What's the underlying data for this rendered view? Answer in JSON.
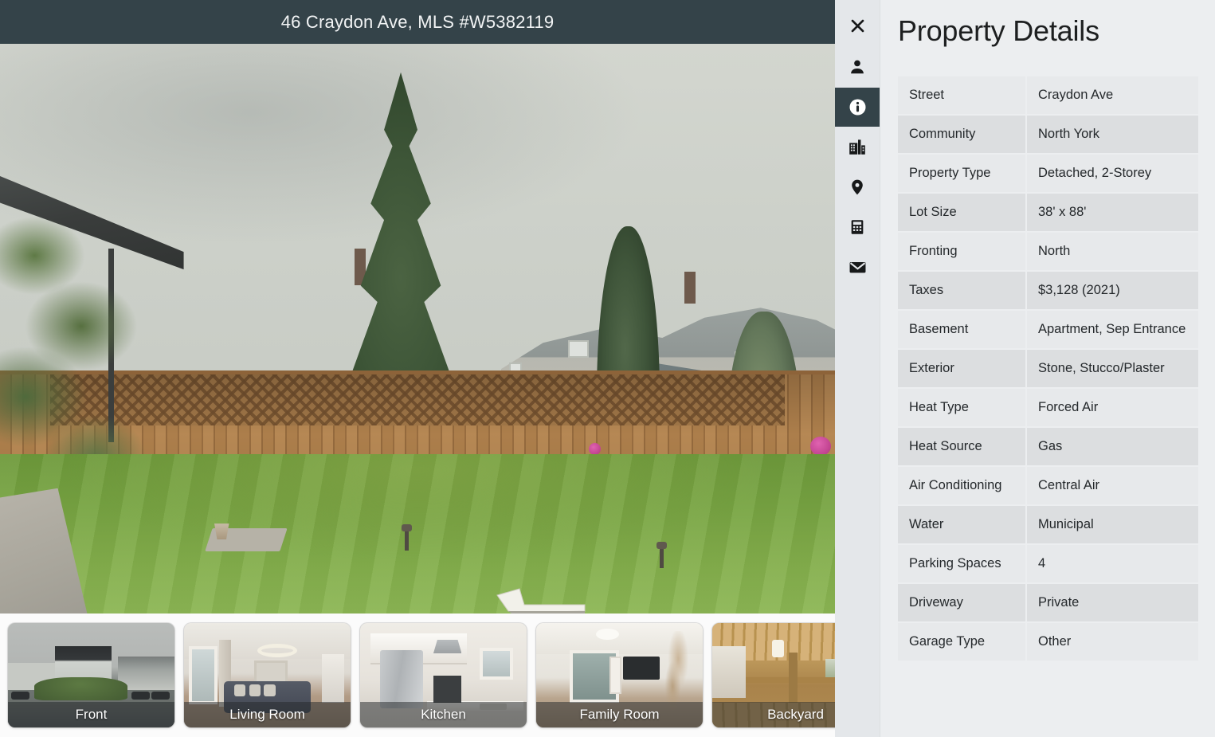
{
  "header": {
    "title": "46 Craydon Ave, MLS #W5382119",
    "bar_color": "#344349"
  },
  "icon_rail": {
    "items": [
      {
        "name": "close-icon",
        "label": "Close",
        "active": false
      },
      {
        "name": "agent-icon",
        "label": "Agent",
        "active": false
      },
      {
        "name": "info-icon",
        "label": "Property Details",
        "active": true
      },
      {
        "name": "buildings-icon",
        "label": "Building",
        "active": false
      },
      {
        "name": "map-pin-icon",
        "label": "Location",
        "active": false
      },
      {
        "name": "calculator-icon",
        "label": "Mortgage Calculator",
        "active": false
      },
      {
        "name": "envelope-icon",
        "label": "Contact",
        "active": false
      }
    ],
    "active_bg": "#344349",
    "rail_bg": "#e4e7ea"
  },
  "panorama": {
    "scene_label": "Backyard",
    "nav_chevron": "chevron-down-icon",
    "hotspot": "floor-arrow-hotspot"
  },
  "thumbnails": [
    {
      "label": "Front",
      "art": "art-front"
    },
    {
      "label": "Living Room",
      "art": "art-living"
    },
    {
      "label": "Kitchen",
      "art": "art-kitchen"
    },
    {
      "label": "Family Room",
      "art": "art-family"
    },
    {
      "label": "Backyard",
      "art": "art-backyard"
    }
  ],
  "details": {
    "title": "Property Details",
    "rows": [
      {
        "key": "Street",
        "value": "Craydon Ave"
      },
      {
        "key": "Community",
        "value": "North York"
      },
      {
        "key": "Property Type",
        "value": "Detached, 2-Storey"
      },
      {
        "key": "Lot Size",
        "value": "38' x 88'"
      },
      {
        "key": "Fronting",
        "value": "North"
      },
      {
        "key": "Taxes",
        "value": "$3,128 (2021)"
      },
      {
        "key": "Basement",
        "value": "Apartment, Sep Entrance"
      },
      {
        "key": "Exterior",
        "value": "Stone, Stucco/Plaster"
      },
      {
        "key": "Heat Type",
        "value": "Forced Air"
      },
      {
        "key": "Heat Source",
        "value": "Gas"
      },
      {
        "key": "Air Conditioning",
        "value": "Central Air"
      },
      {
        "key": "Water",
        "value": "Municipal"
      },
      {
        "key": "Parking Spaces",
        "value": "4"
      },
      {
        "key": "Driveway",
        "value": "Private"
      },
      {
        "key": "Garage Type",
        "value": "Other"
      }
    ],
    "panel_bg": "#eceef0",
    "row_odd_bg": "#e7e9eb",
    "row_even_bg": "#dcdee0"
  }
}
